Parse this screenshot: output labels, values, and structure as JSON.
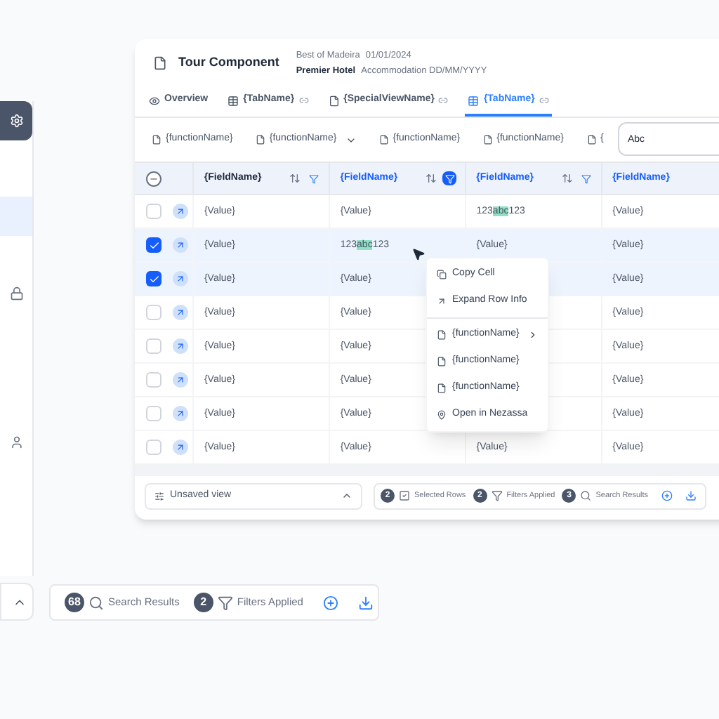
{
  "back_panel": {
    "nav_items": [
      {
        "kind": "blank",
        "selected": true
      },
      {
        "kind": "lock",
        "selected": false
      },
      {
        "kind": "user",
        "selected": false
      }
    ],
    "summary": [
      {
        "count": "68",
        "kind": "search",
        "label": "Search Results"
      },
      {
        "count": "2",
        "kind": "filter",
        "label": "Filters Applied"
      }
    ]
  },
  "window": {
    "title": "Tour Component",
    "meta": [
      {
        "strong": "Best of Madeira",
        "text": "01/01/2024"
      },
      {
        "strong": "Premier Hotel",
        "text": "Accommodation DD/MM/YYYY"
      }
    ]
  },
  "tabs": [
    {
      "label": "Overview",
      "kind": "overview",
      "selected": false
    },
    {
      "label": "{TabName}",
      "kind": "table",
      "selected": false
    },
    {
      "label": "{SpecialViewName}",
      "kind": "view",
      "selected": false
    },
    {
      "label": "{TabName}",
      "kind": "table",
      "selected": true
    }
  ],
  "toolbar": [
    {
      "label": "{functionName}",
      "kind": "action"
    },
    {
      "label": "{functionName}",
      "kind": "dropdown"
    },
    {
      "label": "{functionName}",
      "kind": "action"
    },
    {
      "label": "{functionName}",
      "kind": "action"
    },
    {
      "label": "{",
      "kind": "action"
    }
  ],
  "search": {
    "value": "Abc"
  },
  "table": {
    "select_all": {
      "indeterminate": true
    },
    "columns": [
      {
        "label": "{FieldName}",
        "highlighted": false,
        "kind": "filterable",
        "filter_active": false
      },
      {
        "label": "{FieldName}",
        "highlighted": true,
        "kind": "filterable",
        "filter_active": true
      },
      {
        "label": "{FieldName}",
        "highlighted": true,
        "kind": "filterable",
        "filter_active": false
      },
      {
        "label": "{FieldName}",
        "highlighted": true,
        "kind": "plain"
      }
    ],
    "rows": [
      {
        "checked": false,
        "cells": [
          "{Value}",
          "{Value}",
          "123**abc**123",
          "{Value}"
        ]
      },
      {
        "checked": true,
        "cells": [
          "{Value}",
          "123**abc**123",
          "{Value}",
          "{Value}"
        ]
      },
      {
        "checked": true,
        "cells": [
          "{Value}",
          "{Value}",
          "",
          "{Value}"
        ]
      },
      {
        "checked": false,
        "cells": [
          "{Value}",
          "{Value}",
          "",
          "{Value}"
        ]
      },
      {
        "checked": false,
        "cells": [
          "{Value}",
          "{Value}",
          "",
          "{Value}"
        ]
      },
      {
        "checked": false,
        "cells": [
          "{Value}",
          "{Value}",
          "",
          "{Value}"
        ]
      },
      {
        "checked": false,
        "cells": [
          "{Value}",
          "{Value}",
          "",
          "{Value}"
        ]
      },
      {
        "checked": false,
        "cells": [
          "{Value}",
          "{Value}",
          "{Value}",
          "{Value}"
        ]
      }
    ]
  },
  "context_menu": [
    {
      "kind": "copy",
      "label": "Copy Cell"
    },
    {
      "kind": "expand",
      "label": "Expand Row Info"
    },
    {
      "kind": "divider"
    },
    {
      "kind": "submenu",
      "label": "{functionName}"
    },
    {
      "kind": "file",
      "label": "{functionName}"
    },
    {
      "kind": "file",
      "label": "{functionName}"
    },
    {
      "kind": "pin",
      "label": "Open in Nezassa"
    }
  ],
  "footer": {
    "view": "Unsaved view",
    "summary": [
      {
        "count": "2",
        "kind": "check",
        "label": "Selected Rows"
      },
      {
        "count": "2",
        "kind": "filter",
        "label": "Filters Applied"
      },
      {
        "count": "3",
        "kind": "search",
        "label": "Search Results"
      }
    ]
  }
}
